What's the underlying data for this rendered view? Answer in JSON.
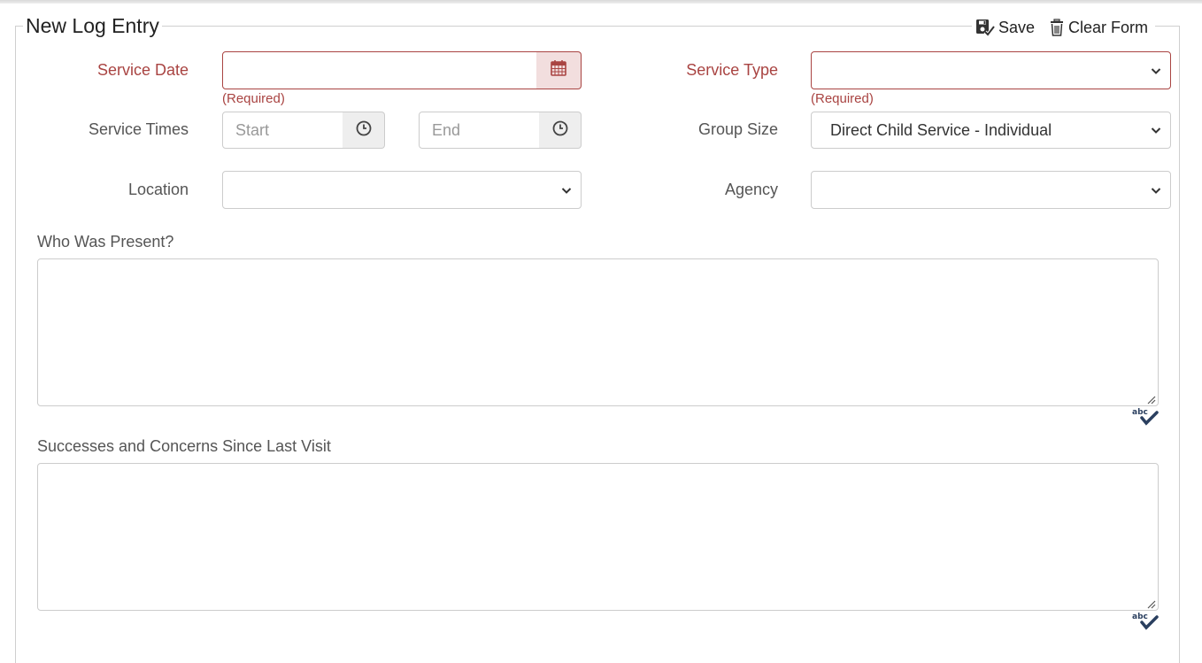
{
  "form": {
    "title": "New Log Entry",
    "toolbar": {
      "save_label": "Save",
      "clear_label": "Clear Form"
    },
    "service_date": {
      "label": "Service Date",
      "value": "",
      "hint": "(Required)",
      "icon": "calendar-icon"
    },
    "service_type": {
      "label": "Service Type",
      "selected": "",
      "hint": "(Required)"
    },
    "service_times": {
      "label": "Service Times",
      "start": {
        "placeholder": "Start",
        "value": "",
        "icon": "clock-icon"
      },
      "end": {
        "placeholder": "End",
        "value": "",
        "icon": "clock-icon"
      }
    },
    "group_size": {
      "label": "Group Size",
      "selected": "Direct Child Service - Individual"
    },
    "location": {
      "label": "Location",
      "selected": ""
    },
    "agency": {
      "label": "Agency",
      "selected": ""
    },
    "who_present": {
      "label": "Who Was Present?",
      "value": "",
      "spellcheck_icon": "spellcheck-icon"
    },
    "successes": {
      "label": "Successes and Concerns Since Last Visit",
      "value": "",
      "spellcheck_icon": "spellcheck-icon"
    }
  },
  "colors": {
    "required": "#a94442",
    "border": "#cccccc",
    "addon": "#eeeeee",
    "addon_error": "#f2dede"
  }
}
